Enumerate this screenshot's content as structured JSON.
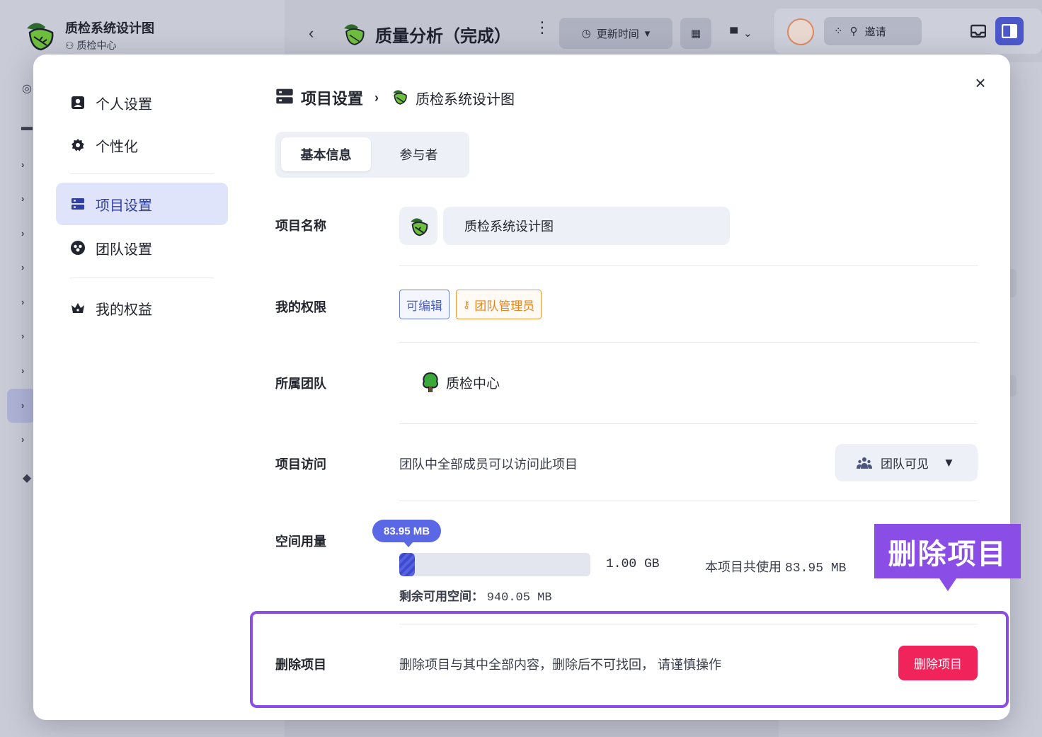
{
  "background": {
    "project": {
      "title": "质检系统设计图",
      "team": "质检中心"
    },
    "toolbar": {
      "doc_title": "质量分析（完成）",
      "sort_label": "更新时间",
      "invite_label": "邀请"
    }
  },
  "modal": {
    "nav": {
      "items": [
        {
          "label": "个人设置",
          "icon": "contact-card-icon"
        },
        {
          "label": "个性化",
          "icon": "gear-icon"
        },
        {
          "label": "项目设置",
          "icon": "server-icon",
          "active": true
        },
        {
          "label": "团队设置",
          "icon": "team-icon"
        },
        {
          "label": "我的权益",
          "icon": "crown-icon"
        }
      ]
    },
    "breadcrumb": {
      "section": "项目设置",
      "project": "质检系统设计图"
    },
    "tabs": [
      {
        "label": "基本信息",
        "active": true
      },
      {
        "label": "参与者",
        "active": false
      }
    ],
    "fields": {
      "name": {
        "label": "项目名称",
        "value": "质检系统设计图"
      },
      "permission": {
        "label": "我的权限",
        "tags": [
          "可编辑",
          "团队管理员"
        ]
      },
      "team": {
        "label": "所属团队",
        "value": "质检中心"
      },
      "access": {
        "label": "项目访问",
        "description": "团队中全部成员可以访问此项目",
        "select_value": "团队可见"
      },
      "storage": {
        "label": "空间用量",
        "used_badge": "83.95 MB",
        "total": "1.00 GB",
        "used_text_prefix": "本项目共使用",
        "used_value": "83.95 MB",
        "remain_label": "剩余可用空间：",
        "remain_value": "940.05 MB",
        "used_fraction": 0.082
      },
      "delete": {
        "label": "删除项目",
        "description": "删除项目与其中全部内容，删除后不可找回，  请谨慎操作",
        "button": "删除项目"
      }
    }
  },
  "annotation": {
    "callout": "删除项目"
  },
  "colors": {
    "accent": "#5a68e6",
    "nav_active_bg": "#dfe4fb",
    "danger": "#f0245a",
    "annotation": "#8a4ee6",
    "tag_edit": "#4b5fc4",
    "tag_admin": "#e6871e"
  }
}
